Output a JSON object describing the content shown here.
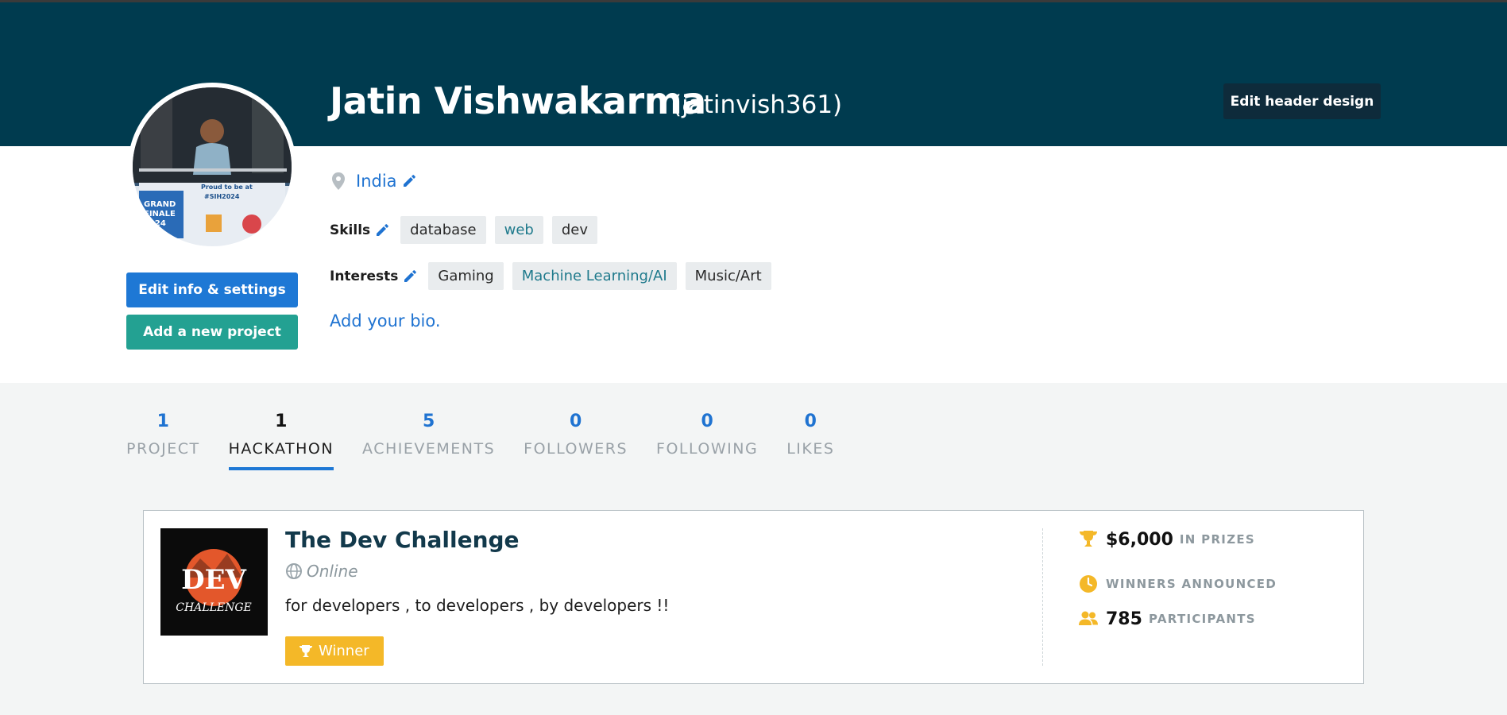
{
  "colors": {
    "header_bg": "#003b4f",
    "accent_blue": "#1e78d5",
    "accent_teal": "#23a192",
    "winner_yellow": "#f4b828"
  },
  "profile": {
    "name": "Jatin Vishwakarma",
    "handle": "(jatinvish361)",
    "location": "India",
    "skills_label": "Skills",
    "skills": [
      "database",
      "web",
      "dev"
    ],
    "interests_label": "Interests",
    "interests": [
      "Gaming",
      "Machine Learning/AI",
      "Music/Art"
    ],
    "bio_link": "Add your bio.",
    "avatar_icon": "profile-photo"
  },
  "header": {
    "edit_header_label": "Edit header design"
  },
  "actions": {
    "edit_info_label": "Edit info & settings",
    "add_project_label": "Add a new project"
  },
  "stats": [
    {
      "value": "1",
      "label": "PROJECT"
    },
    {
      "value": "1",
      "label": "HACKATHON",
      "active": true
    },
    {
      "value": "5",
      "label": "ACHIEVEMENTS"
    },
    {
      "value": "0",
      "label": "FOLLOWERS"
    },
    {
      "value": "0",
      "label": "FOLLOWING"
    },
    {
      "value": "0",
      "label": "LIKES"
    }
  ],
  "hackathon_card": {
    "title": "The Dev Challenge",
    "location": "Online",
    "description": "for developers , to developers , by developers !!",
    "badge": "Winner",
    "prize_amount": "$6,000",
    "prize_suffix": "IN PRIZES",
    "status": "WINNERS ANNOUNCED",
    "participants_count": "785",
    "participants_suffix": "PARTICIPANTS",
    "logo_text": "DEV CHALLENGE"
  }
}
